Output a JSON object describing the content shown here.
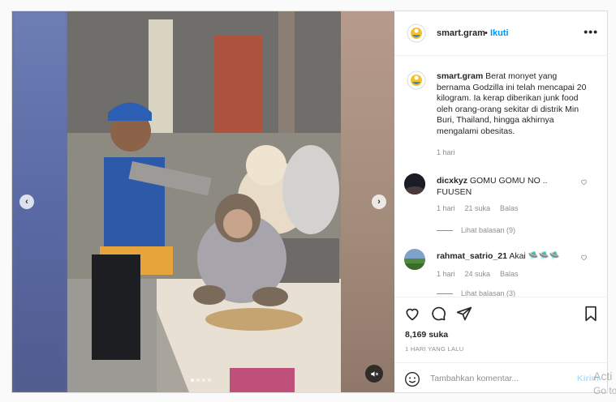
{
  "header": {
    "username": "smart.gram",
    "separator": "•",
    "follow_label": "Ikuti",
    "more_label": "•••"
  },
  "caption": {
    "username": "smart.gram",
    "text": "Berat monyet yang bernama Godzilla ini telah mencapai 20 kilogram. Ia kerap diberikan junk food oleh orang-orang sekitar di distrik Min Buri, Thailand, hingga akhirnya mengalami obesitas.",
    "time": "1 hari"
  },
  "comments": [
    {
      "username": "dicxkyz",
      "text": "GOMU GOMU NO .. FUUSEN",
      "time": "1 hari",
      "likes": "21 suka",
      "reply_label": "Balas",
      "view_replies": "Lihat balasan (9)"
    },
    {
      "username": "rahmat_satrio_21",
      "text": "Akai 🛸🛸🛸",
      "time": "1 hari",
      "likes": "24 suka",
      "reply_label": "Balas",
      "view_replies": "Lihat balasan (3)"
    }
  ],
  "post": {
    "likes": "8,169 suka",
    "date": "1 HARI YANG LALU",
    "comment_placeholder": "Tambahkan komentar...",
    "post_label": "Kirim"
  },
  "media": {
    "prev_label": "‹",
    "next_label": "›",
    "slide_count": 4,
    "active_slide": 1
  },
  "watermark": {
    "line1": "Acti",
    "line2": "Go to"
  },
  "colors": {
    "link_blue": "#0095f6",
    "muted_grey": "#8e8e8e",
    "text_dark": "#262626"
  },
  "icons": {
    "like": "heart-icon",
    "comment": "comment-icon",
    "share": "paper-plane-icon",
    "save": "bookmark-icon",
    "emoji": "smile-icon",
    "mute": "speaker-muted-icon"
  }
}
